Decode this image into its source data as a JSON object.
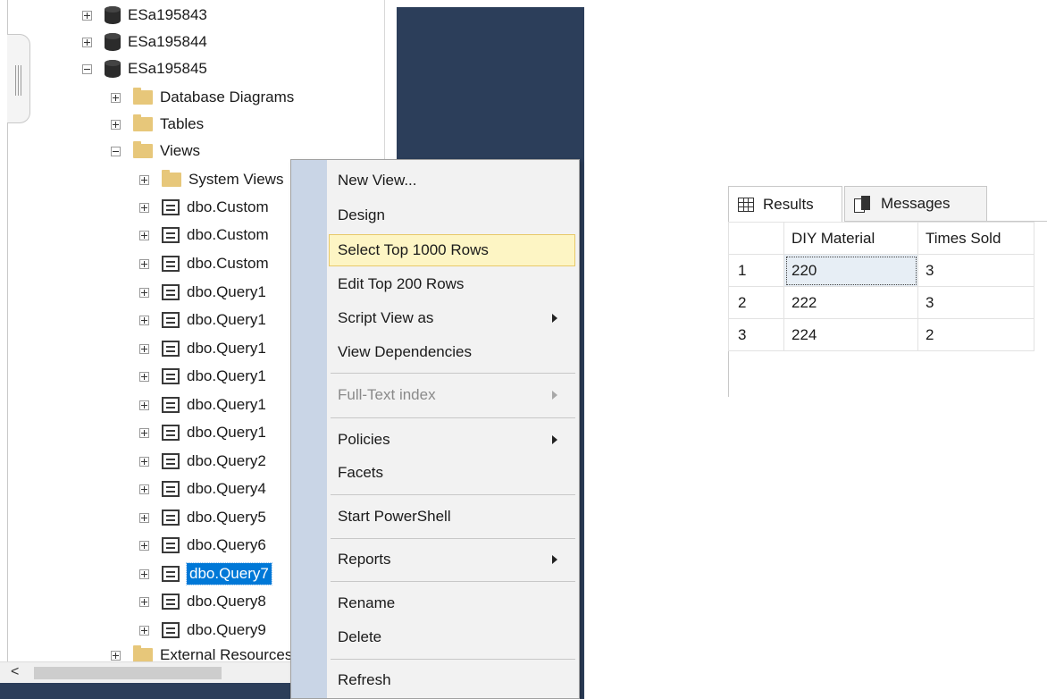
{
  "tree": {
    "databases": [
      {
        "label": "ESa195843",
        "expanded": false
      },
      {
        "label": "ESa195844",
        "expanded": false
      },
      {
        "label": "ESa195845",
        "expanded": true
      }
    ],
    "folders": [
      {
        "label": "Database Diagrams",
        "expanded": false
      },
      {
        "label": "Tables",
        "expanded": false
      },
      {
        "label": "Views",
        "expanded": true
      }
    ],
    "view_children": [
      {
        "label": "System Views",
        "type": "folder"
      },
      {
        "label": "dbo.Custom",
        "type": "view"
      },
      {
        "label": "dbo.Custom",
        "type": "view"
      },
      {
        "label": "dbo.Custom",
        "type": "view"
      },
      {
        "label": "dbo.Query1",
        "type": "view"
      },
      {
        "label": "dbo.Query1",
        "type": "view"
      },
      {
        "label": "dbo.Query1",
        "type": "view"
      },
      {
        "label": "dbo.Query1",
        "type": "view"
      },
      {
        "label": "dbo.Query1",
        "type": "view"
      },
      {
        "label": "dbo.Query1",
        "type": "view"
      },
      {
        "label": "dbo.Query2",
        "type": "view"
      },
      {
        "label": "dbo.Query4",
        "type": "view"
      },
      {
        "label": "dbo.Query5",
        "type": "view"
      },
      {
        "label": "dbo.Query6",
        "type": "view"
      },
      {
        "label": "dbo.Query7",
        "type": "view",
        "selected": true
      },
      {
        "label": "dbo.Query8",
        "type": "view"
      },
      {
        "label": "dbo.Query9",
        "type": "view"
      }
    ],
    "after": {
      "label": "External Resources"
    }
  },
  "context_menu": {
    "items": [
      {
        "label": "New View..."
      },
      {
        "label": "Design"
      },
      {
        "label": "Select Top 1000 Rows",
        "highlighted": true
      },
      {
        "label": "Edit Top 200 Rows"
      },
      {
        "label": "Script View as",
        "submenu": true
      },
      {
        "label": "View Dependencies"
      },
      {
        "label": "Full-Text index",
        "submenu": true,
        "disabled": true
      },
      {
        "label": "Policies",
        "submenu": true
      },
      {
        "label": "Facets"
      },
      {
        "label": "Start PowerShell"
      },
      {
        "label": "Reports",
        "submenu": true
      },
      {
        "label": "Rename"
      },
      {
        "label": "Delete"
      },
      {
        "label": "Refresh"
      }
    ]
  },
  "results": {
    "tabs": {
      "results": "Results",
      "messages": "Messages"
    },
    "columns": [
      "DIY Material",
      "Times Sold"
    ],
    "rows": [
      {
        "n": "1",
        "material": "220",
        "sold": "3"
      },
      {
        "n": "2",
        "material": "222",
        "sold": "3"
      },
      {
        "n": "3",
        "material": "224",
        "sold": "2"
      }
    ]
  },
  "colors": {
    "selection": "#0078d7",
    "menu_highlight": "#fdf5c4",
    "editor_bg": "#2c3e5a"
  },
  "scrollbar": {
    "left_arrow": "<"
  }
}
